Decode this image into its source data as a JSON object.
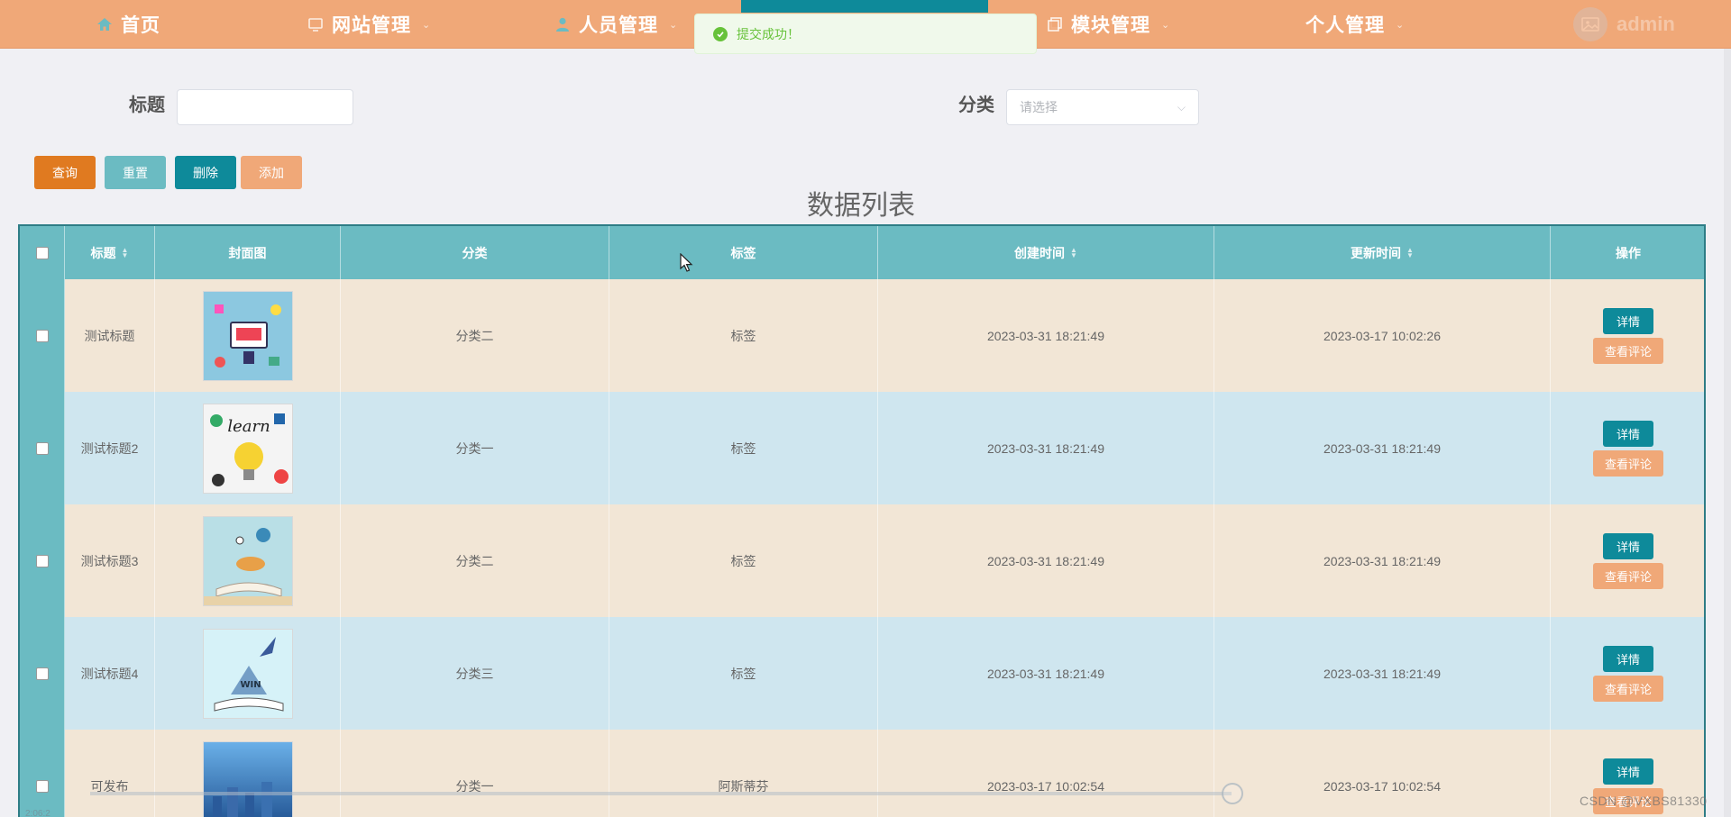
{
  "nav": {
    "items": [
      {
        "label": "首页",
        "icon": "home-icon"
      },
      {
        "label": "网站管理",
        "icon": "monitor-icon"
      },
      {
        "label": "人员管理",
        "icon": "user-icon"
      },
      {
        "label": "模块管理",
        "icon": "copy-icon"
      },
      {
        "label": "个人管理",
        "icon": ""
      }
    ],
    "user": "admin",
    "accent_color": "#0e8a9a",
    "bar_color": "#f0a878"
  },
  "toast": {
    "message": "提交成功！",
    "icon": "success-check-icon",
    "color": "#67c23a"
  },
  "search": {
    "title_label": "标题",
    "title_value": "",
    "category_label": "分类",
    "category_placeholder": "请选择"
  },
  "actions": {
    "query": "查询",
    "reset": "重置",
    "delete": "删除",
    "add": "添加"
  },
  "list_title": "数据列表",
  "table": {
    "columns": [
      "标题",
      "封面图",
      "分类",
      "标签",
      "创建时间",
      "更新时间",
      "操作"
    ],
    "rows": [
      {
        "title": "测试标题",
        "category": "分类二",
        "tag": "标签",
        "created": "2023-03-31 18:21:49",
        "updated": "2023-03-17 10:02:26"
      },
      {
        "title": "测试标题2",
        "category": "分类一",
        "tag": "标签",
        "created": "2023-03-31 18:21:49",
        "updated": "2023-03-31 18:21:49"
      },
      {
        "title": "测试标题3",
        "category": "分类二",
        "tag": "标签",
        "created": "2023-03-31 18:21:49",
        "updated": "2023-03-31 18:21:49"
      },
      {
        "title": "测试标题4",
        "category": "分类三",
        "tag": "标签",
        "created": "2023-03-31 18:21:49",
        "updated": "2023-03-31 18:21:49"
      },
      {
        "title": "可发布",
        "category": "分类一",
        "tag": "阿斯蒂芬",
        "created": "2023-03-17 10:02:54",
        "updated": "2023-03-17 10:02:54"
      }
    ],
    "row_detail_label": "详情",
    "row_comment_label": "查看评论",
    "row_colors": [
      "#f2e6d6",
      "#cfe6ef"
    ]
  },
  "watermark": "CSDN @VXBS81330",
  "video_time": "2:06:2"
}
